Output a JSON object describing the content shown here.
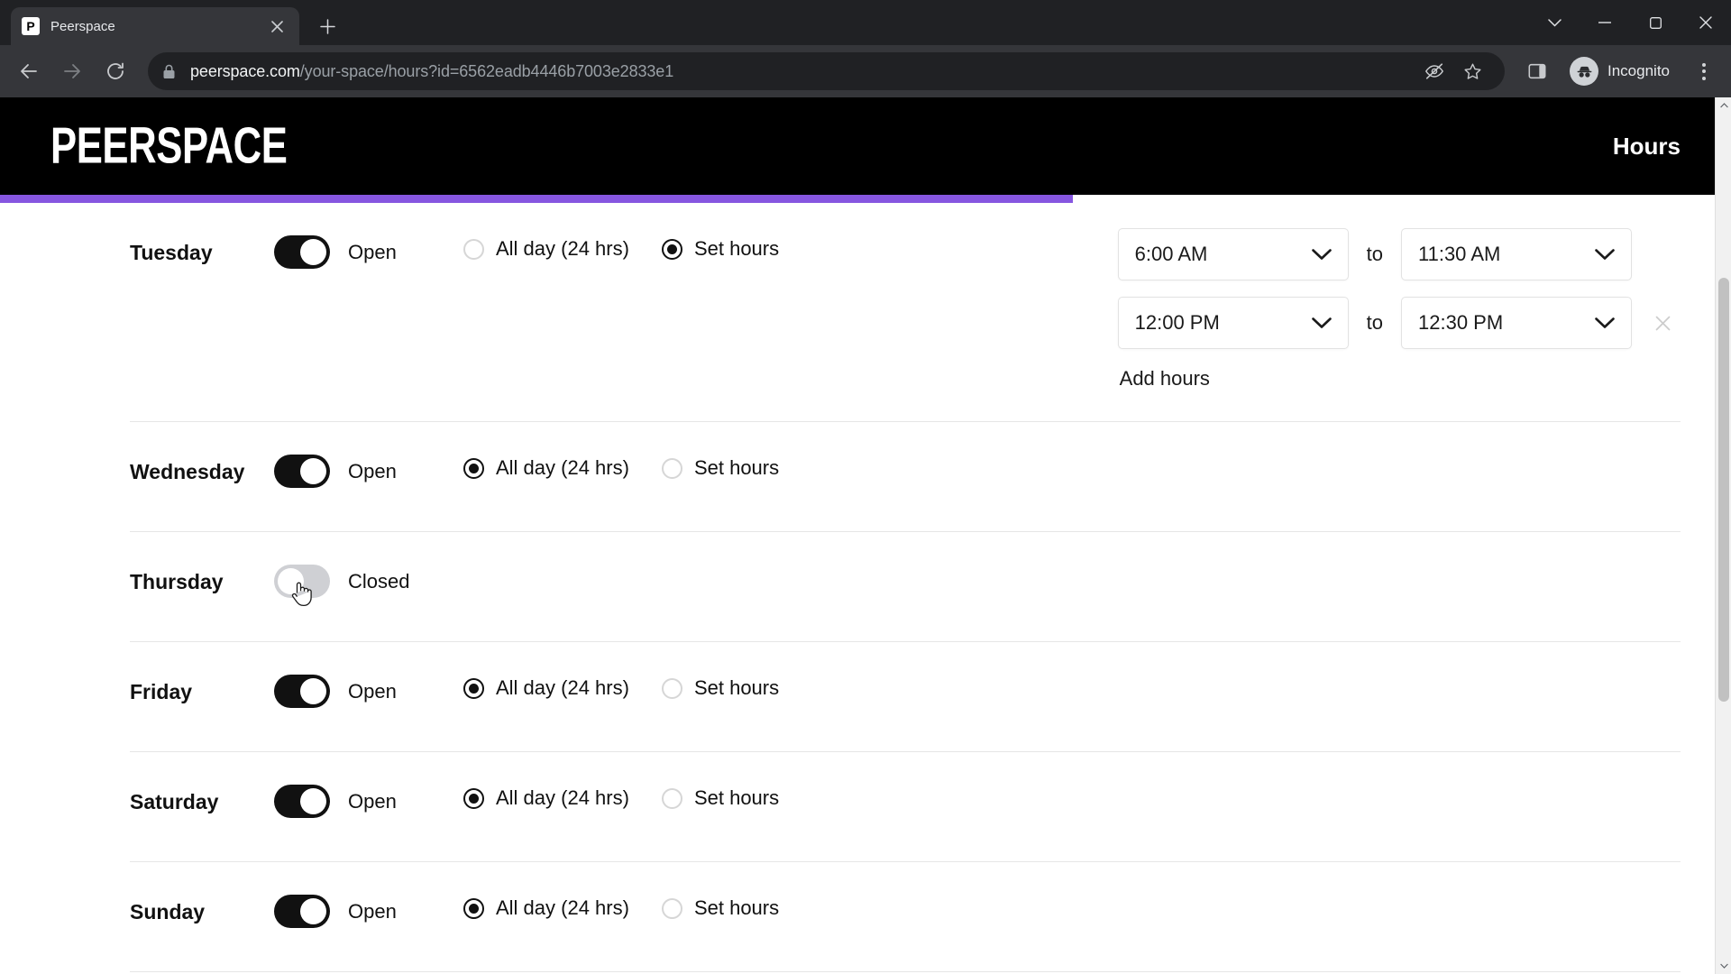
{
  "browser": {
    "tab": {
      "title": "Peerspace",
      "favicon_letter": "P",
      "favicon_name": "peerspace-favicon",
      "close_icon": "×"
    },
    "new_tab_icon": "+",
    "window_controls": [
      {
        "name": "minimize-group-chevron-icon",
        "glyph": "⌄"
      },
      {
        "name": "minimize-icon",
        "glyph": "–"
      },
      {
        "name": "maximize-icon",
        "glyph": "▢"
      },
      {
        "name": "close-window-icon",
        "glyph": "✕"
      }
    ],
    "nav": {
      "back_icon": "←",
      "forward_icon": "→",
      "reload_icon": "⟳"
    },
    "omnibox": {
      "lock_icon": "lock-icon",
      "host": "peerspace.com",
      "path": "/your-space/hours?id=6562eadb4446b7003e2833e1",
      "full_url": "peerspace.com/your-space/hours?id=6562eadb4446b7003e2833e1"
    },
    "omnibox_actions": [
      {
        "name": "third-party-cookie-blocked-icon"
      },
      {
        "name": "bookmark-star-icon"
      },
      {
        "name": "side-panel-icon"
      }
    ],
    "profile": {
      "label": "Incognito",
      "avatar_icon": "incognito-hat-icon"
    },
    "menu_icon": "three-dot-menu-icon"
  },
  "site": {
    "logo_text": "PEERSPACE",
    "page_title": "Hours",
    "progress_percent": 62,
    "accent_color": "#8656e0",
    "header_bg": "#000000"
  },
  "labels": {
    "open": "Open",
    "closed": "Closed",
    "all_day": "All day (24 hrs)",
    "set_hours": "Set hours",
    "to": "to",
    "add_hours": "Add hours",
    "remove_icon": "×",
    "chevron_down_icon": "chevron-down-icon"
  },
  "days": [
    {
      "name": "Tuesday",
      "is_open": true,
      "toggle_label": "Open",
      "mode": "set_hours",
      "all_day_selected": false,
      "set_hours_selected": true,
      "time_ranges": [
        {
          "start": "6:00 AM",
          "end": "11:30 AM",
          "removable": false
        },
        {
          "start": "12:00 PM",
          "end": "12:30 PM",
          "removable": true
        }
      ],
      "show_add_hours": true
    },
    {
      "name": "Wednesday",
      "is_open": true,
      "toggle_label": "Open",
      "mode": "all_day",
      "all_day_selected": true,
      "set_hours_selected": false,
      "time_ranges": [],
      "show_add_hours": false
    },
    {
      "name": "Thursday",
      "is_open": false,
      "toggle_label": "Closed",
      "mode": "none",
      "all_day_selected": false,
      "set_hours_selected": false,
      "time_ranges": [],
      "show_add_hours": false,
      "cursor_over_toggle": true
    },
    {
      "name": "Friday",
      "is_open": true,
      "toggle_label": "Open",
      "mode": "all_day",
      "all_day_selected": true,
      "set_hours_selected": false,
      "time_ranges": [],
      "show_add_hours": false
    },
    {
      "name": "Saturday",
      "is_open": true,
      "toggle_label": "Open",
      "mode": "all_day",
      "all_day_selected": true,
      "set_hours_selected": false,
      "time_ranges": [],
      "show_add_hours": false
    },
    {
      "name": "Sunday",
      "is_open": true,
      "toggle_label": "Open",
      "mode": "all_day",
      "all_day_selected": true,
      "set_hours_selected": false,
      "time_ranges": [],
      "show_add_hours": false
    }
  ]
}
